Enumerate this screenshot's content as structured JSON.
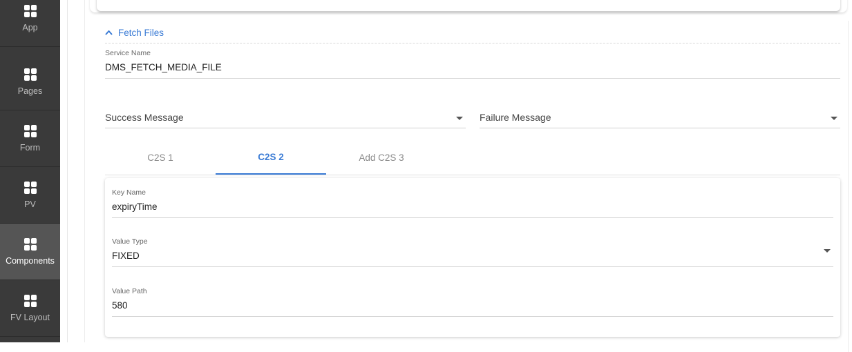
{
  "sidebar": {
    "items": [
      {
        "label": "App",
        "icon": "app-grid-icon"
      },
      {
        "label": "Pages",
        "icon": "pages-grid-icon"
      },
      {
        "label": "Form",
        "icon": "form-grid-icon"
      },
      {
        "label": "PV",
        "icon": "pv-grid-icon"
      },
      {
        "label": "Components",
        "icon": "components-grid-icon",
        "active": true
      },
      {
        "label": "FV Layout",
        "icon": "fv-layout-grid-icon"
      }
    ]
  },
  "fetch_files": {
    "title": "Fetch Files",
    "service_name_label": "Service Name",
    "service_name_value": "DMS_FETCH_MEDIA_FILE",
    "success_message_placeholder": "Success Message",
    "failure_message_placeholder": "Failure Message",
    "tabs": [
      {
        "label": "C2S 1"
      },
      {
        "label": "C2S 2",
        "active": true
      },
      {
        "label": "Add C2S 3"
      }
    ],
    "c2s": {
      "key_name_label": "Key Name",
      "key_name_value": "expiryTime",
      "value_type_label": "Value Type",
      "value_type_value": "FIXED",
      "value_path_label": "Value Path",
      "value_path_value": "580"
    }
  },
  "colors": {
    "sidebar_bg": "#3a3a3a",
    "sidebar_active_bg": "#555555",
    "accent": "#3a7bd5"
  }
}
